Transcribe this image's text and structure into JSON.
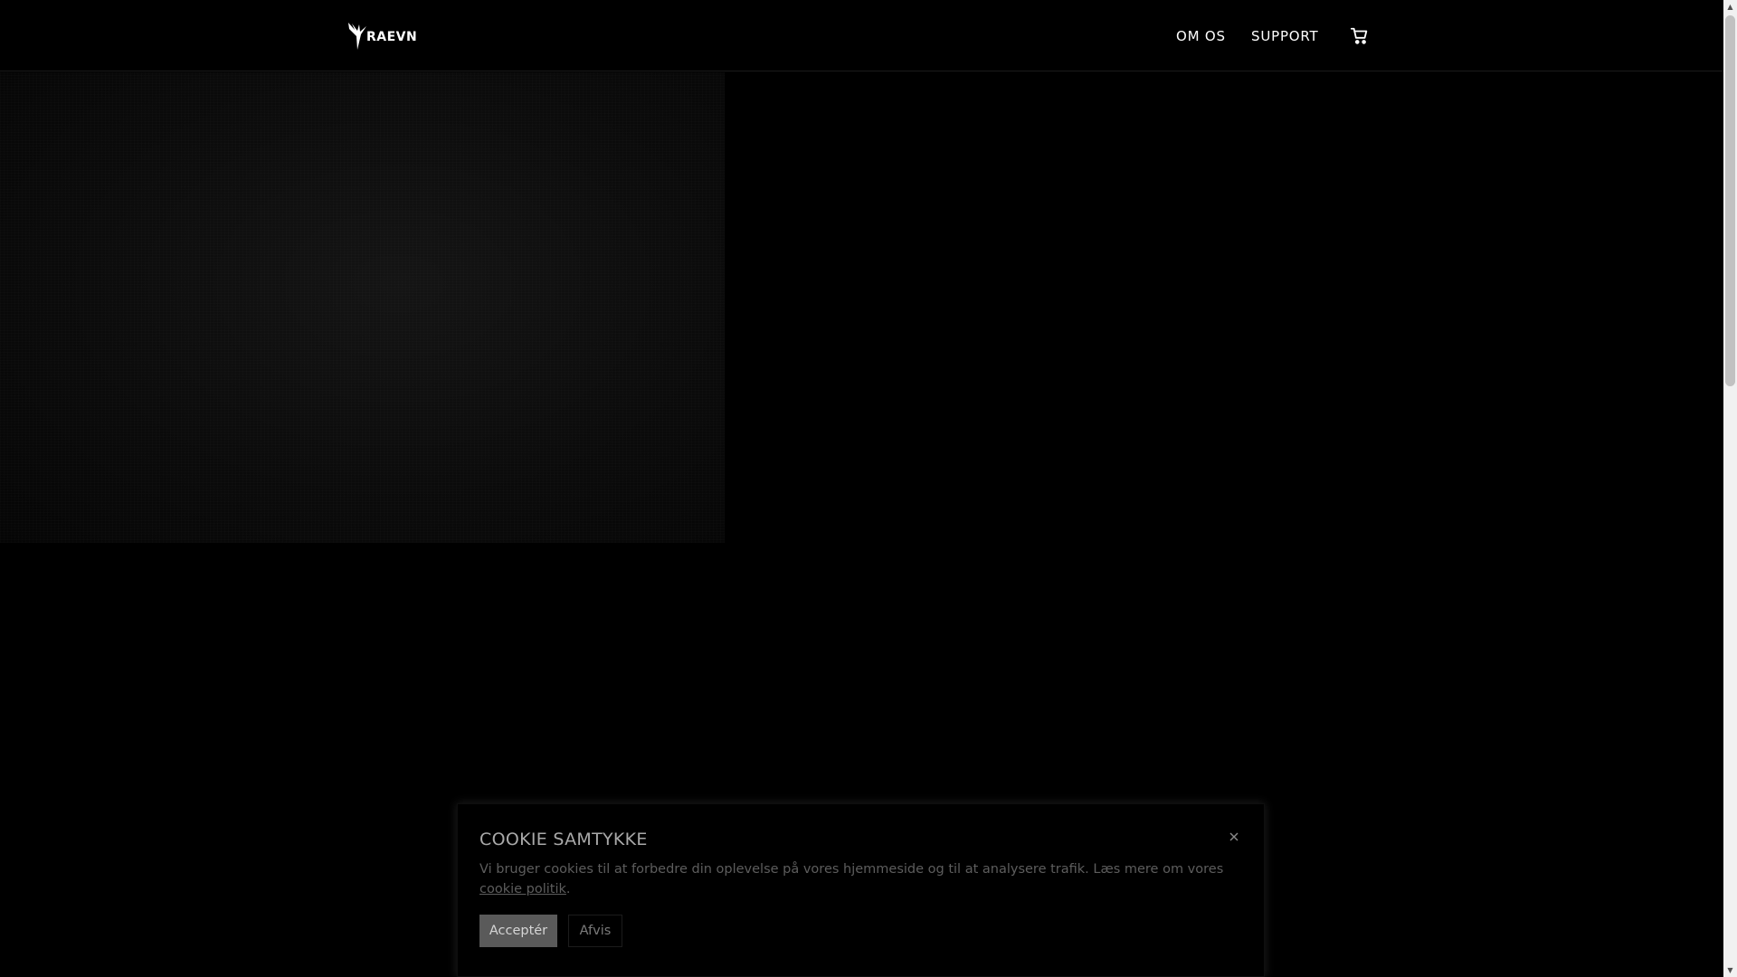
{
  "header": {
    "logo_text": "RAEVN",
    "nav": {
      "about_label": "OM OS",
      "support_label": "SUPPORT"
    },
    "cart_icon": "cart-icon"
  },
  "hero": {
    "media": "dark-video-area"
  },
  "cookie_banner": {
    "title": "COOKIE SAMTYKKE",
    "text_before_link": "Vi bruger cookies til at forbedre din oplevelse på vores hjemmeside og til at analysere trafik. Læs mere om vores ",
    "link_label": "cookie politik",
    "text_after_link": ".",
    "accept_label": "Acceptér",
    "decline_label": "Afvis",
    "close_icon": "close-icon"
  },
  "colors": {
    "background": "#000000",
    "accept_button": "#5a5a5a",
    "cookie_text": "#5d5d5d"
  }
}
